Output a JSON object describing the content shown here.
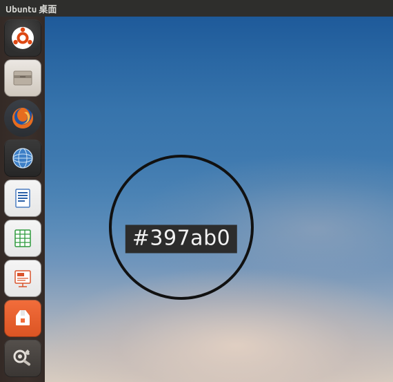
{
  "panel": {
    "title": "Ubuntu 桌面"
  },
  "launcher": {
    "items": [
      {
        "name": "dash",
        "icon": "ubuntu-logo-icon"
      },
      {
        "name": "files",
        "icon": "file-manager-icon"
      },
      {
        "name": "firefox",
        "icon": "firefox-icon"
      },
      {
        "name": "web-browser",
        "icon": "globe-icon"
      },
      {
        "name": "writer",
        "icon": "document-icon"
      },
      {
        "name": "calc",
        "icon": "spreadsheet-icon"
      },
      {
        "name": "impress",
        "icon": "presentation-icon"
      },
      {
        "name": "software",
        "icon": "software-center-icon"
      },
      {
        "name": "settings",
        "icon": "settings-icon"
      }
    ]
  },
  "color_picker": {
    "hex": "#397ab0"
  }
}
